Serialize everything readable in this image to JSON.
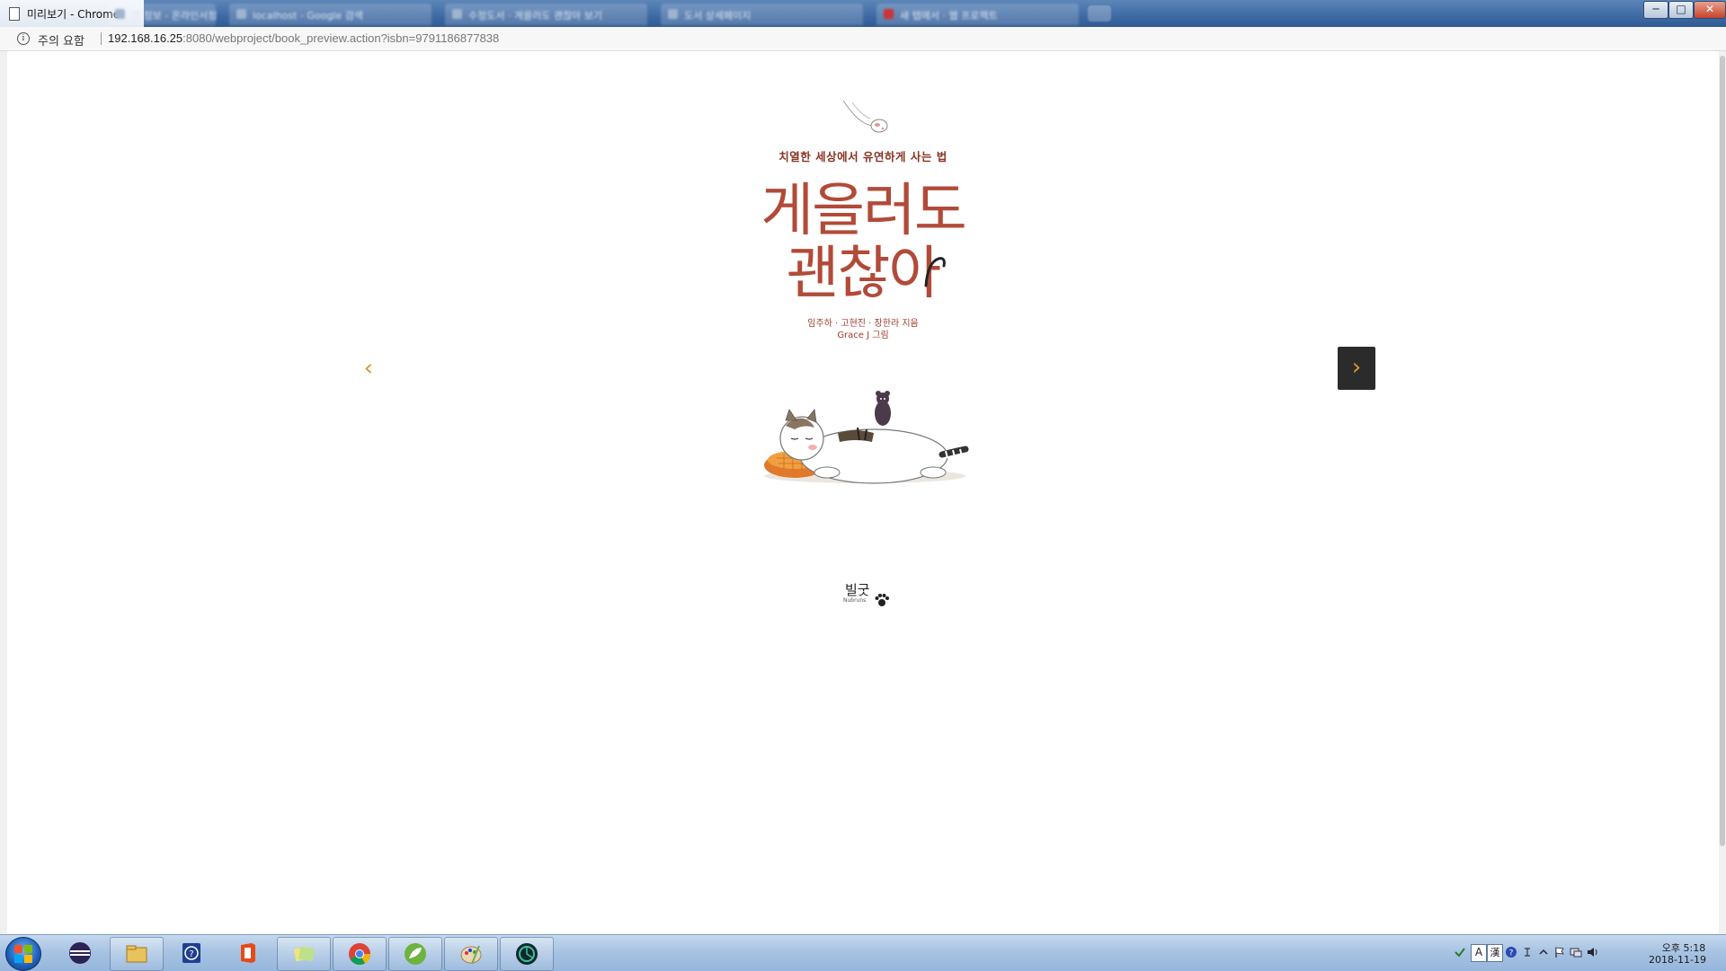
{
  "window": {
    "title": "미리보기 - Chrome",
    "background_tabs": [
      "책 정보 - 온라인서점",
      "localhost - Google 검색",
      "수정도서 · 게을러도 괜찮아 보기",
      "도서 상세페이지",
      "새 탭에서 · 웹 프로젝트"
    ],
    "minimize_label": "─",
    "maximize_label": "□",
    "close_label": "✕"
  },
  "address_bar": {
    "security_label": "주의 요함",
    "url_host": "192.168.16.25",
    "url_path": ":8080/webproject/book_preview.action?isbn=9791186877838"
  },
  "book": {
    "subtitle": "치열한 세상에서 유연하게 사는 법",
    "title_line1": "게을러도",
    "title_line2": "괜찮아",
    "authors": "임주하 · 고현진 · 장한라 지음",
    "illustrator": "Grace J 그림",
    "publisher": "빌굿",
    "publisher_sub": "Nubruns"
  },
  "navigation": {
    "prev_label": "‹",
    "next_label": "›"
  },
  "taskbar": {
    "items": [
      "eclipse-icon",
      "file-explorer-icon",
      "help-icon",
      "office-icon",
      "sticky-notes-icon",
      "chrome-icon",
      "spring-tool-suite-icon",
      "paint-icon",
      "system-monitor-icon"
    ]
  },
  "tray": {
    "ime_label": "A",
    "hanja_label": "漢",
    "time": "오후 5:18",
    "date": "2018-11-19"
  },
  "colors": {
    "title_red": "#b24a39",
    "nav_arrow_orange": "#d39a2f",
    "next_button_bg": "#2b2b2b"
  }
}
